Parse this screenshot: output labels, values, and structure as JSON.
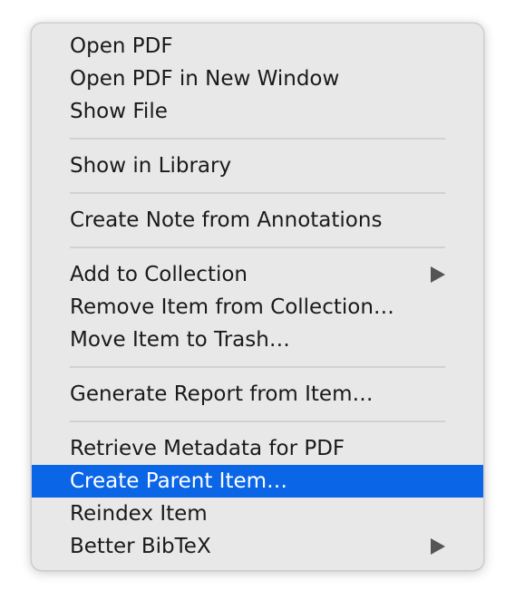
{
  "menu": {
    "groups": [
      {
        "items": [
          {
            "label": "Open PDF"
          },
          {
            "label": "Open PDF in New Window"
          },
          {
            "label": "Show File"
          }
        ]
      },
      {
        "items": [
          {
            "label": "Show in Library"
          }
        ]
      },
      {
        "items": [
          {
            "label": "Create Note from Annotations"
          }
        ]
      },
      {
        "items": [
          {
            "label": "Add to Collection",
            "submenu": true
          },
          {
            "label": "Remove Item from Collection…"
          },
          {
            "label": "Move Item to Trash…"
          }
        ]
      },
      {
        "items": [
          {
            "label": "Generate Report from Item…"
          }
        ]
      },
      {
        "items": [
          {
            "label": "Retrieve Metadata for PDF"
          },
          {
            "label": "Create Parent Item…",
            "highlighted": true
          },
          {
            "label": "Reindex Item"
          },
          {
            "label": "Better BibTeX",
            "submenu": true
          }
        ]
      }
    ]
  },
  "colors": {
    "highlight": "#0a65e7",
    "menu_background": "#e8e8e8",
    "separator": "#d1d1d1"
  },
  "icons": {
    "submenu_arrow": "triangle-right-icon"
  }
}
